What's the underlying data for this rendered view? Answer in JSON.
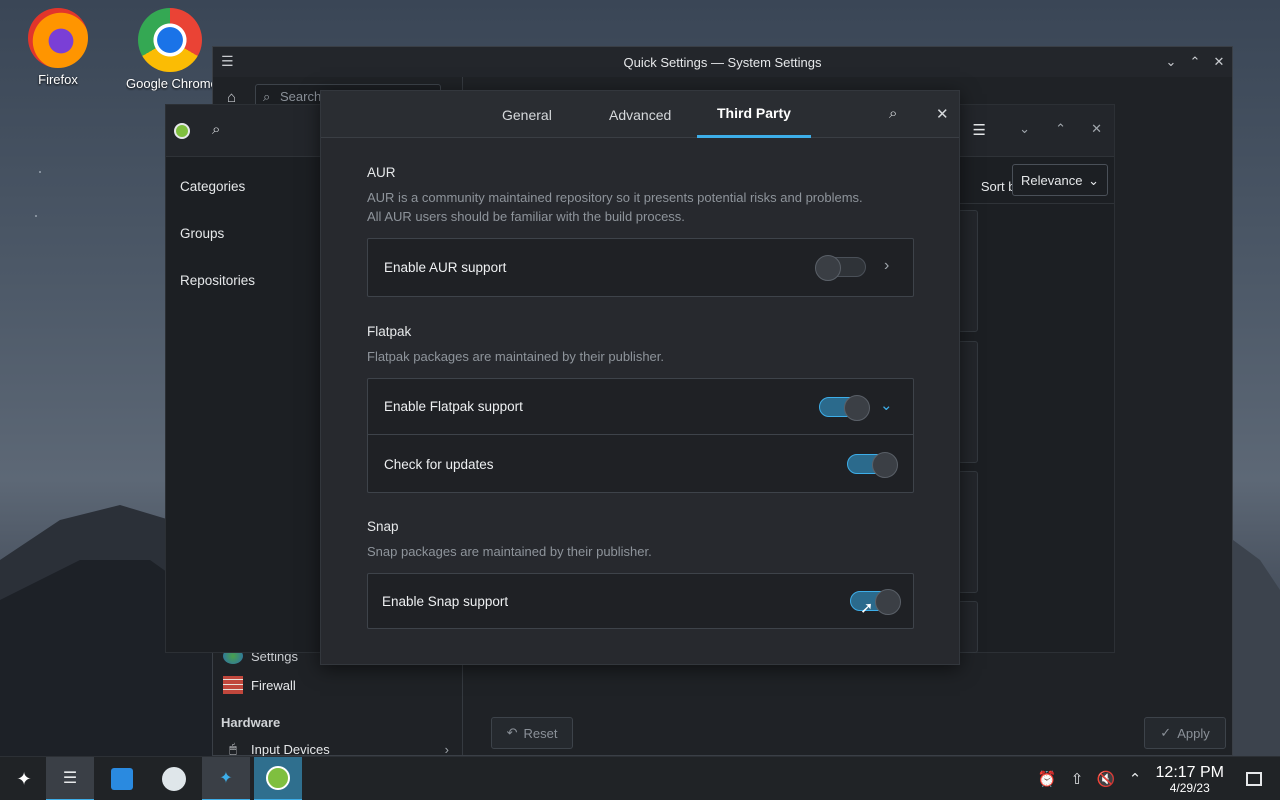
{
  "desktop": {
    "icons": [
      {
        "label": "Firefox"
      },
      {
        "label": "Google Chrome"
      }
    ]
  },
  "system_settings": {
    "title": "Quick Settings — System Settings",
    "search_placeholder": "Search",
    "items": [
      {
        "label": "Settings"
      },
      {
        "label": "Firewall"
      }
    ],
    "section_hardware": "Hardware",
    "input_devices": "Input Devices",
    "reset_label": "Reset",
    "apply_label": "Apply"
  },
  "pamac": {
    "nav": [
      "Categories",
      "Groups",
      "Repositories"
    ],
    "sort_label": "Sort by",
    "sort_value": "Relevance"
  },
  "dialog": {
    "tabs": [
      "General",
      "Advanced",
      "Third Party"
    ],
    "active_tab": "Third Party",
    "aur": {
      "title": "AUR",
      "desc_line1": "AUR is a community maintained repository so it presents potential risks and problems.",
      "desc_line2": "All AUR users should be familiar with the build process.",
      "enable_label": "Enable AUR support",
      "enabled": false
    },
    "flatpak": {
      "title": "Flatpak",
      "desc": "Flatpak packages are maintained by their publisher.",
      "enable_label": "Enable Flatpak support",
      "enabled": true,
      "check_updates_label": "Check for updates",
      "check_updates": true
    },
    "snap": {
      "title": "Snap",
      "desc": "Snap packages are maintained by their publisher.",
      "enable_label": "Enable Snap support",
      "enabled": true
    }
  },
  "taskbar": {
    "time": "12:17 PM",
    "date": "4/29/23"
  },
  "colors": {
    "accent": "#3daee9",
    "toggle_on": "#2b6a8c"
  }
}
